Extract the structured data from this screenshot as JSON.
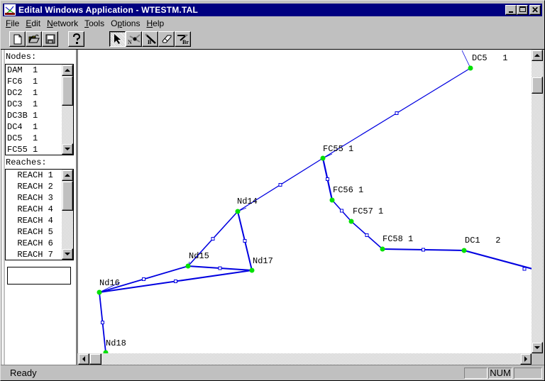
{
  "window": {
    "title": "Edital Windows Application - WTESTM.TAL",
    "controls": {
      "minimize": "_",
      "maximize": "□",
      "close": "×"
    }
  },
  "menu": [
    {
      "label": "File",
      "accel": "F",
      "rest": "ile"
    },
    {
      "label": "Edit",
      "accel": "E",
      "rest": "dit"
    },
    {
      "label": "Network",
      "accel": "N",
      "rest": "etwork"
    },
    {
      "label": "Tools",
      "accel": "T",
      "rest": "ools"
    },
    {
      "label": "Options",
      "accel": "p",
      "pre": "O",
      "rest": "tions"
    },
    {
      "label": "Help",
      "accel": "H",
      "rest": "elp"
    }
  ],
  "toolbar": {
    "buttons": [
      {
        "name": "new-file",
        "icon": "new-document-icon"
      },
      {
        "name": "open-file",
        "icon": "open-folder-icon"
      },
      {
        "name": "save-file",
        "icon": "floppy-disk-icon"
      },
      {
        "name": "help",
        "icon": "help-question-icon"
      },
      {
        "name": "select-tool",
        "icon": "pointer-arrow-icon",
        "pressed": true
      },
      {
        "name": "node-tool",
        "icon": "node-tool-icon",
        "label": "N"
      },
      {
        "name": "branch-tool",
        "icon": "branch-tool-icon",
        "label": "B"
      },
      {
        "name": "erase-tool",
        "icon": "eraser-icon"
      },
      {
        "name": "branch-reach-tool",
        "icon": "branch-reach-tool-icon",
        "label": "Br"
      }
    ]
  },
  "left_panel": {
    "nodes_label": "Nodes:",
    "nodes": [
      "DAM  1",
      "FC6  1",
      "DC2  1",
      "DC3  1",
      "DC3B 1",
      "DC4  1",
      "DC5  1",
      "FC55 1"
    ],
    "reaches_label": "Reaches:",
    "reaches": [
      "  REACH 1",
      "  REACH 2",
      "  REACH 3",
      "  REACH 4",
      "  REACH 4",
      "  REACH 5",
      "  REACH 6",
      "  REACH 7"
    ],
    "edit_value": ""
  },
  "network": {
    "line_color": "#0000e0",
    "node_color": "#00e000",
    "nodes": [
      {
        "id": "DC5",
        "label": "DC5   1"
      },
      {
        "id": "FC55",
        "label": "FC55 1"
      },
      {
        "id": "FC56",
        "label": "FC56 1"
      },
      {
        "id": "FC57",
        "label": "FC57 1"
      },
      {
        "id": "FC58",
        "label": "FC58 1"
      },
      {
        "id": "DC1",
        "label": "DC1   2"
      },
      {
        "id": "Nd14",
        "label": "Nd14"
      },
      {
        "id": "Nd15",
        "label": "Nd15"
      },
      {
        "id": "Nd16",
        "label": "Nd16"
      },
      {
        "id": "Nd17",
        "label": "Nd17"
      },
      {
        "id": "Nd18",
        "label": "Nd18"
      }
    ]
  },
  "status": {
    "text": "Ready",
    "panes": [
      "",
      "NUM",
      ""
    ]
  }
}
